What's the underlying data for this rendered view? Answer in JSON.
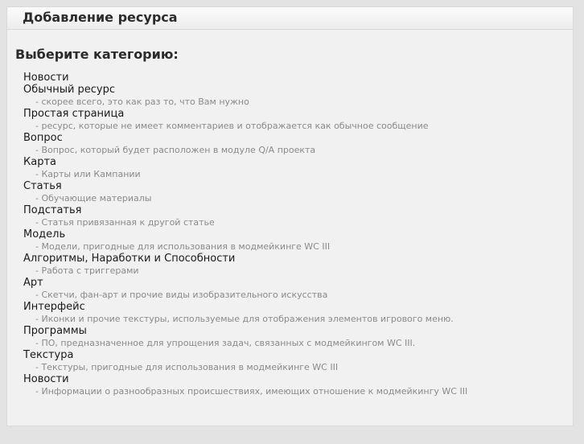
{
  "panel": {
    "title": "Добавление ресурса"
  },
  "section_heading": "Выберите категорию:",
  "categories": [
    {
      "label": "Новости",
      "description": ""
    },
    {
      "label": "Обычный ресурс",
      "description": "- скорее всего, это как раз то, что Вам нужно"
    },
    {
      "label": "Простая страница",
      "description": "- ресурс, которые не имеет комментариев и отображается как обычное сообщение"
    },
    {
      "label": "Вопрос",
      "description": "- Вопрос, который будет расположен в модуле Q/A проекта"
    },
    {
      "label": "Карта",
      "description": "- Карты или Кампании"
    },
    {
      "label": "Статья",
      "description": "- Обучающие материалы"
    },
    {
      "label": "Подстатья",
      "description": "- Статья привязанная к другой статье"
    },
    {
      "label": "Модель",
      "description": "- Модели, пригодные для использования в модмейкинге WC III"
    },
    {
      "label": "Алгоритмы, Наработки и Способности",
      "description": "- Работа с триггерами"
    },
    {
      "label": "Арт",
      "description": "- Скетчи, фан-арт и прочие виды изобразительного искусства"
    },
    {
      "label": "Интерфейс",
      "description": "- Иконки и прочие текстуры, используемые для отображения элементов игрового меню."
    },
    {
      "label": "Программы",
      "description": "- ПО, предназначенное для упрощения задач, связанных с модмейкингом WC III."
    },
    {
      "label": "Текстура",
      "description": "- Текстуры, пригодные для использования в модмейкинге WC III"
    },
    {
      "label": "Новости",
      "description": "- Информации о разнообразных происшествиях, имеющих отношение к модмейкингу WC III"
    }
  ]
}
